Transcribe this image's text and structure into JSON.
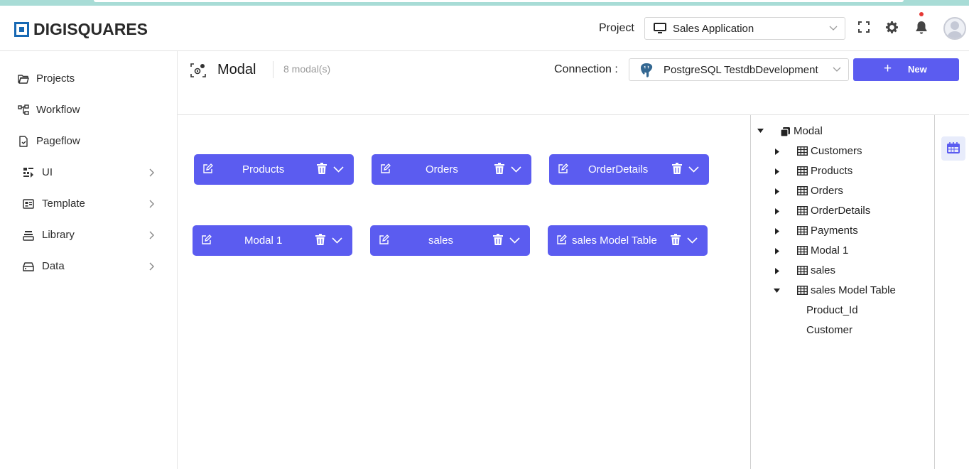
{
  "app": {
    "logo_text": "DIGISQUARES",
    "accent_color": "#5b5cf0",
    "brand_color": "#1768b3"
  },
  "header": {
    "project_label": "Project",
    "project_value": "Sales Application",
    "icons": [
      "monitor-icon",
      "chevron-down-icon",
      "fullscreen-icon",
      "gear-icon",
      "bell-icon",
      "avatar"
    ]
  },
  "sidebar": {
    "items": [
      {
        "label": "Projects",
        "icon": "folder-open-icon",
        "has_arrow": false
      },
      {
        "label": "Workflow",
        "icon": "workflow-icon",
        "has_arrow": false
      },
      {
        "label": "Pageflow",
        "icon": "pageflow-icon",
        "has_arrow": false
      },
      {
        "label": "UI",
        "icon": "ui-icon",
        "has_arrow": true
      },
      {
        "label": "Template",
        "icon": "template-icon",
        "has_arrow": true
      },
      {
        "label": "Library",
        "icon": "library-icon",
        "has_arrow": true
      },
      {
        "label": "Data",
        "icon": "data-icon",
        "has_arrow": true
      }
    ]
  },
  "main": {
    "title": "Modal",
    "count": "8 modal(s)",
    "connection_label": "Connection :",
    "connection_value": "PostgreSQL TestdbDevelopment",
    "new_button": {
      "plus": "+",
      "label": "New"
    },
    "models": [
      {
        "name": "Products"
      },
      {
        "name": "Orders"
      },
      {
        "name": "OrderDetails"
      },
      {
        "name": "Modal 1"
      },
      {
        "name": "sales"
      },
      {
        "name": "sales Model Table"
      }
    ]
  },
  "tree": {
    "root": {
      "label": "Modal",
      "expanded": true
    },
    "nodes": [
      {
        "label": "Customers",
        "expanded": false
      },
      {
        "label": "Products",
        "expanded": false
      },
      {
        "label": "Orders",
        "expanded": false
      },
      {
        "label": "OrderDetails",
        "expanded": false
      },
      {
        "label": "Payments",
        "expanded": false
      },
      {
        "label": "Modal 1",
        "expanded": false
      },
      {
        "label": "sales",
        "expanded": false
      },
      {
        "label": "sales Model Table",
        "expanded": true
      }
    ],
    "fields": [
      {
        "label": "Product_Id"
      },
      {
        "label": "Customer"
      }
    ]
  }
}
